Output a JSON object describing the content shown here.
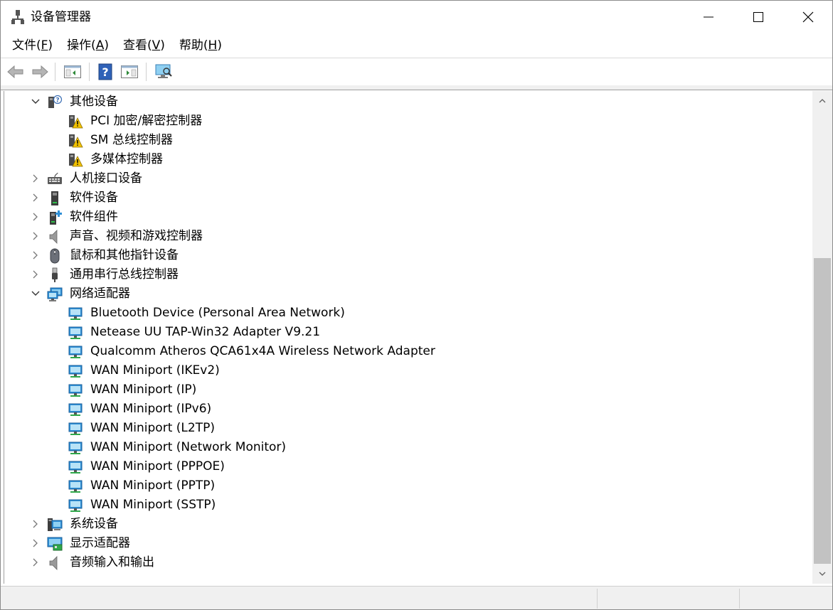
{
  "window": {
    "title": "设备管理器"
  },
  "menu": [
    {
      "label": "文件(",
      "key": "F",
      "end": ")"
    },
    {
      "label": "操作(",
      "key": "A",
      "end": ")"
    },
    {
      "label": "查看(",
      "key": "V",
      "end": ")"
    },
    {
      "label": "帮助(",
      "key": "H",
      "end": ")"
    }
  ],
  "toolbar": {
    "back": "back-arrow-icon",
    "forward": "forward-arrow-icon",
    "show_hide": "console-tree-icon",
    "help": "help-icon",
    "properties": "action-pane-icon",
    "scan": "scan-hardware-icon"
  },
  "tree": {
    "other_devices": {
      "label": "其他设备",
      "children": [
        "PCI 加密/解密控制器",
        "SM 总线控制器",
        "多媒体控制器"
      ]
    },
    "hid": "人机接口设备",
    "software_devices": "软件设备",
    "software_components": "软件组件",
    "sound": "声音、视频和游戏控制器",
    "mouse": "鼠标和其他指针设备",
    "usb": "通用串行总线控制器",
    "network_adapters": {
      "label": "网络适配器",
      "children": [
        "Bluetooth Device (Personal Area Network)",
        "Netease UU TAP-Win32 Adapter V9.21",
        "Qualcomm Atheros QCA61x4A Wireless Network Adapter",
        "WAN Miniport (IKEv2)",
        "WAN Miniport (IP)",
        "WAN Miniport (IPv6)",
        "WAN Miniport (L2TP)",
        "WAN Miniport (Network Monitor)",
        "WAN Miniport (PPPOE)",
        "WAN Miniport (PPTP)",
        "WAN Miniport (SSTP)"
      ]
    },
    "system_devices": "系统设备",
    "display_adapters": "显示适配器",
    "audio_io": "音频输入和输出"
  },
  "colors": {
    "warning": "#f2c200",
    "network": "#2e8fd6",
    "scroll_thumb": "#c2c2c2"
  }
}
